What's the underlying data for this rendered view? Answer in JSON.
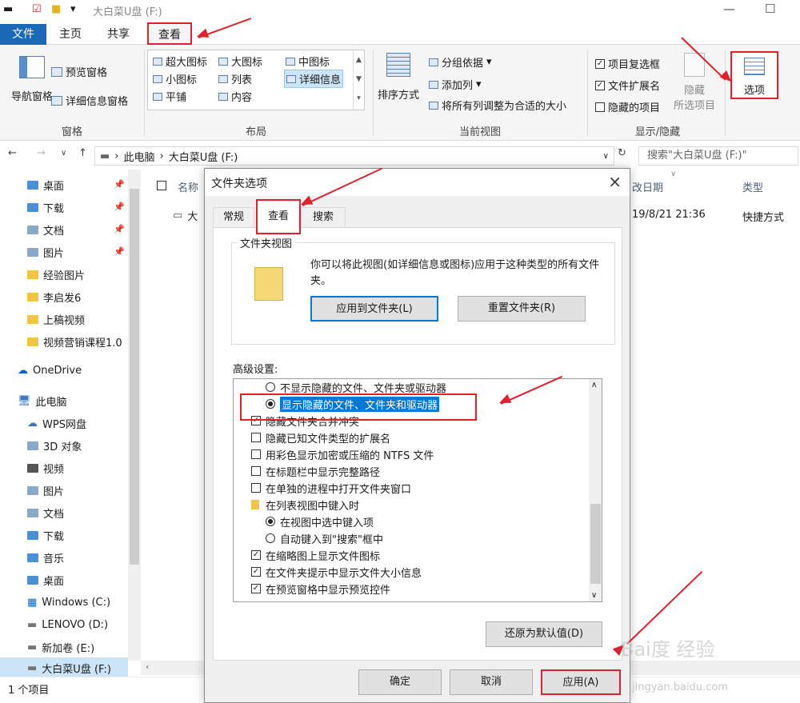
{
  "window": {
    "title": "大白菜U盘 (F:)",
    "minimize_glyph": "—",
    "maximize_glyph": "☐"
  },
  "ribbon_tabs": [
    "文件",
    "主页",
    "共享",
    "查看"
  ],
  "ribbon": {
    "panes": {
      "nav_pane": "导航窗格",
      "preview_pane": "预览窗格",
      "details_pane": "详细信息窗格",
      "group": "窗格"
    },
    "layout": {
      "items": [
        "超大图标",
        "大图标",
        "中图标",
        "小图标",
        "列表",
        "详细信息",
        "平铺",
        "内容"
      ],
      "group": "布局"
    },
    "current_view": {
      "sort_by": "排序方式",
      "group_by": "分组依据",
      "add_columns": "添加列",
      "size_columns": "将所有列调整为合适的大小",
      "group": "当前视图"
    },
    "show_hide": {
      "item_checkboxes": "项目复选框",
      "file_extensions": "文件扩展名",
      "hidden_items": "隐藏的项目",
      "hide_selected": "隐藏",
      "hide_selected_2": "所选项目",
      "group": "显示/隐藏"
    },
    "options": "选项"
  },
  "address": {
    "path_root": "此电脑",
    "path_drive": "大白菜U盘 (F:)",
    "search_placeholder": "搜索\"大白菜U盘 (F:)\""
  },
  "nav": {
    "quick_access": [
      "桌面",
      "下载",
      "文档",
      "图片",
      "经验图片",
      "李启发6",
      "上稿视频",
      "视频营销课程1.0"
    ],
    "onedrive": "OneDrive",
    "this_pc": "此电脑",
    "pc_items": [
      "WPS网盘",
      "3D 对象",
      "视频",
      "图片",
      "文档",
      "下载",
      "音乐",
      "桌面",
      "Windows (C:)",
      "LENOVO (D:)",
      "新加卷 (E:)",
      "大白菜U盘 (F:)"
    ]
  },
  "filelist": {
    "columns": [
      "名称",
      "改日期",
      "类型"
    ],
    "row": {
      "name": "大",
      "date": "19/8/21 21:36",
      "type": "快捷方式"
    }
  },
  "status": {
    "count": "1 个项目"
  },
  "dialog": {
    "title": "文件夹选项",
    "tabs": [
      "常规",
      "查看",
      "搜索"
    ],
    "folder_views": {
      "legend": "文件夹视图",
      "description": "你可以将此视图(如详细信息或图标)应用于这种类型的所有文件夹。",
      "apply_button": "应用到文件夹(L)",
      "reset_button": "重置文件夹(R)"
    },
    "advanced_label": "高级设置:",
    "advanced_items": [
      {
        "type": "radio",
        "checked": false,
        "label": "不显示隐藏的文件、文件夹或驱动器"
      },
      {
        "type": "radio",
        "checked": true,
        "label": "显示隐藏的文件、文件夹和驱动器"
      },
      {
        "type": "checkbox",
        "checked": true,
        "label": "隐藏文件夹合并冲突"
      },
      {
        "type": "checkbox",
        "checked": false,
        "label": "隐藏已知文件类型的扩展名"
      },
      {
        "type": "checkbox",
        "checked": false,
        "label": "用彩色显示加密或压缩的 NTFS 文件"
      },
      {
        "type": "checkbox",
        "checked": false,
        "label": "在标题栏中显示完整路径"
      },
      {
        "type": "checkbox",
        "checked": false,
        "label": "在单独的进程中打开文件夹窗口"
      },
      {
        "type": "folder",
        "checked": false,
        "label": "在列表视图中键入时"
      },
      {
        "type": "radio",
        "checked": true,
        "label": "在视图中选中键入项"
      },
      {
        "type": "radio",
        "checked": false,
        "label": "自动键入到\"搜索\"框中"
      },
      {
        "type": "checkbox",
        "checked": true,
        "label": "在缩略图上显示文件图标"
      },
      {
        "type": "checkbox",
        "checked": true,
        "label": "在文件夹提示中显示文件大小信息"
      },
      {
        "type": "checkbox",
        "checked": true,
        "label": "在预览窗格中显示预览控件"
      }
    ],
    "restore_button": "还原为默认值(D)",
    "ok_button": "确定",
    "cancel_button": "取消",
    "apply_button": "应用(A)"
  },
  "watermark": {
    "brand": "Bai度 经验",
    "url": "jingyan.baidu.com"
  },
  "colors": {
    "accent": "#1a69b7",
    "annotation_red": "#e0202a",
    "selection": "#0078d7",
    "folder_yellow": "#f3c544"
  }
}
